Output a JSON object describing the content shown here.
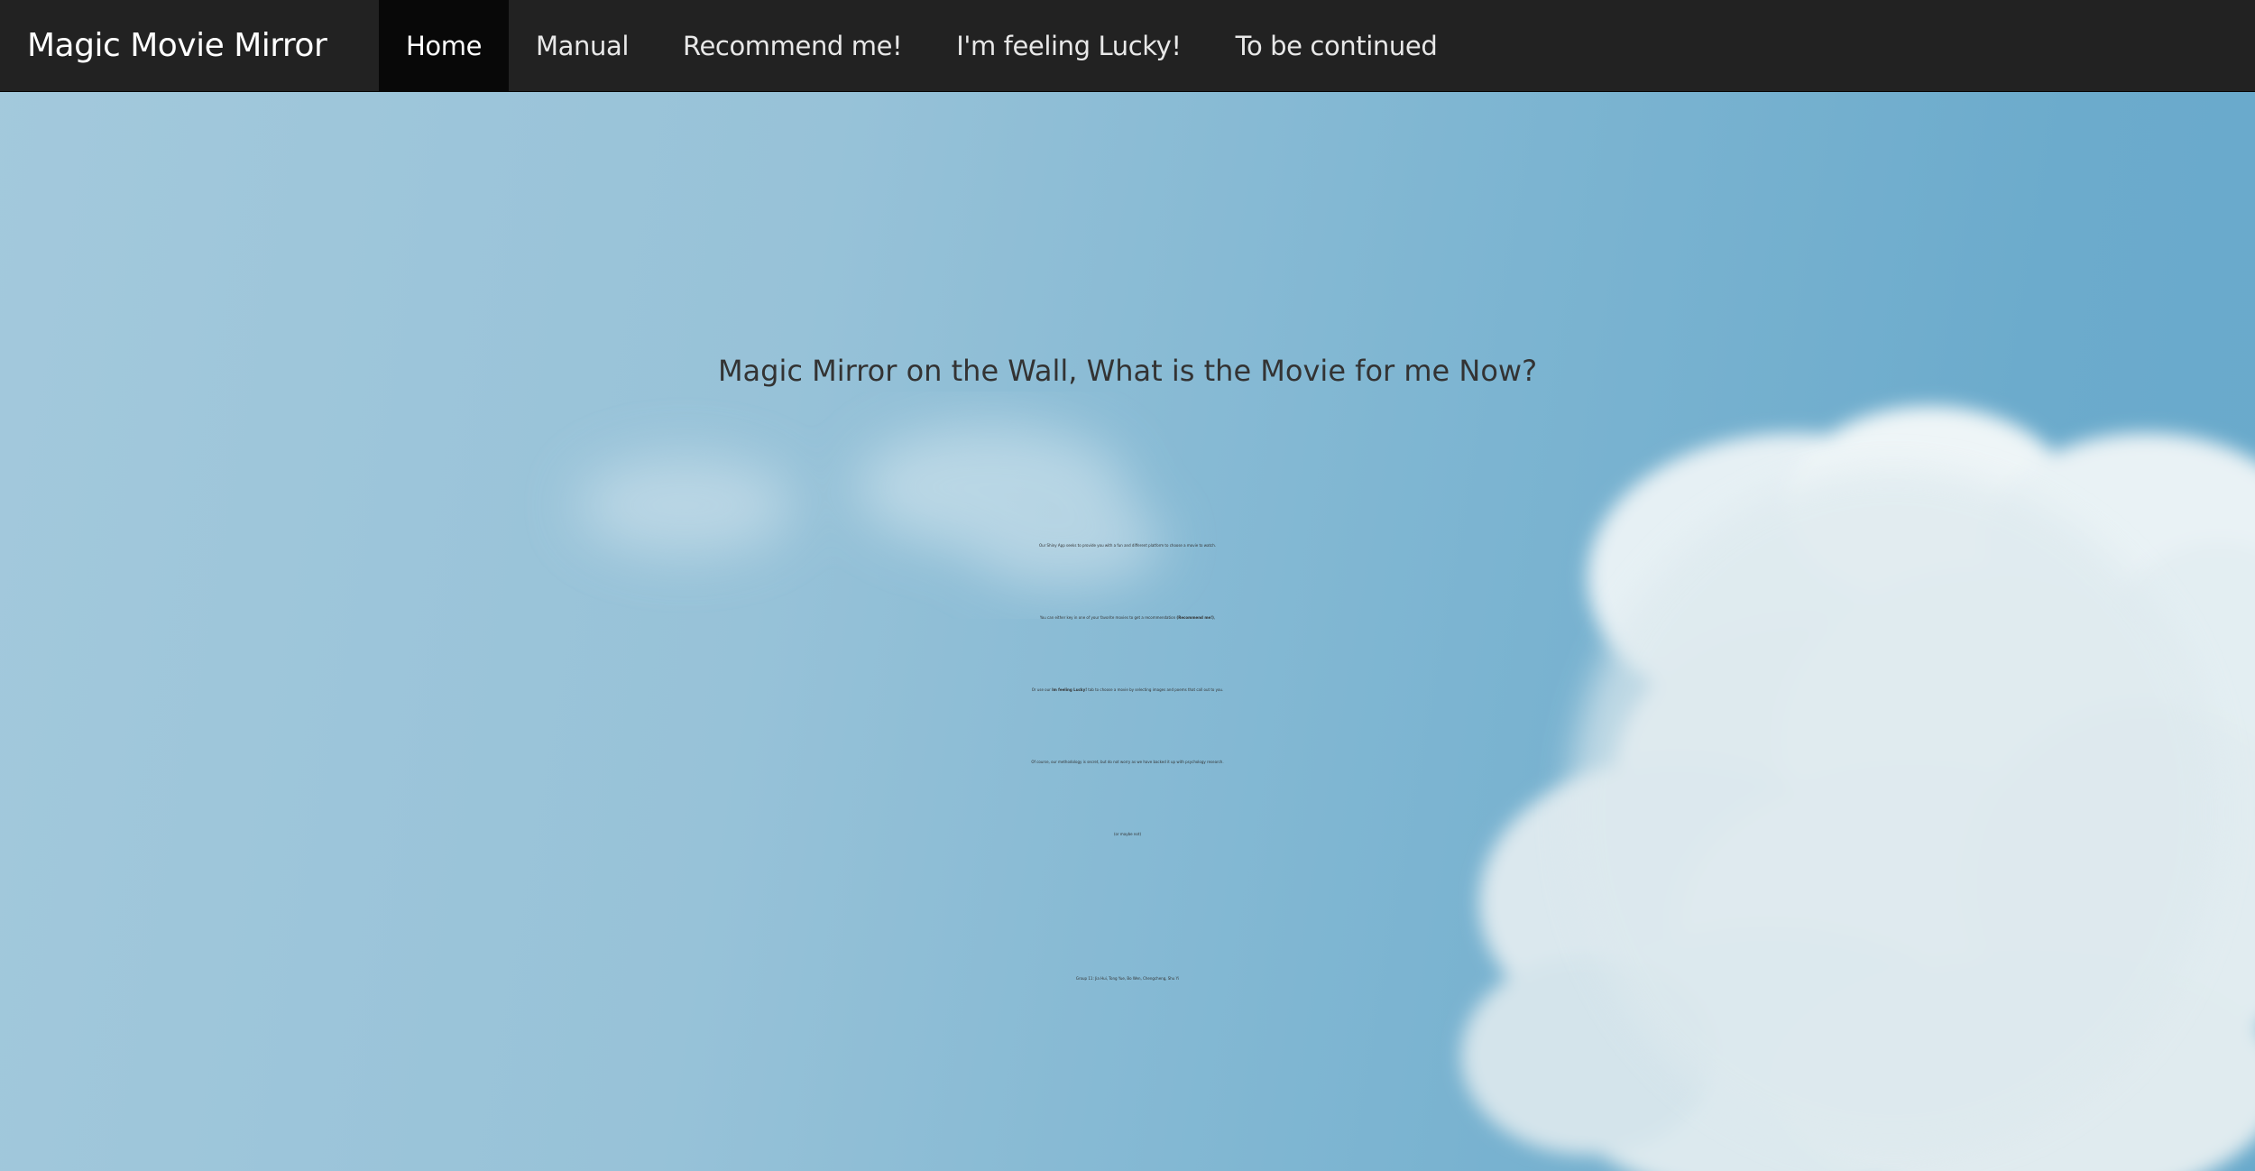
{
  "navbar": {
    "brand": "Magic Movie Mirror",
    "tabs": [
      {
        "label": "Home",
        "active": true
      },
      {
        "label": "Manual",
        "active": false
      },
      {
        "label": "Recommend me!",
        "active": false
      },
      {
        "label": "I'm feeling Lucky!",
        "active": false
      },
      {
        "label": "To be continued",
        "active": false
      }
    ]
  },
  "main": {
    "title": "Magic Mirror on the Wall, What is the Movie for me Now?",
    "line1": "Our Shiny App seeks to provide you with a fun and different platform to choose a movie to watch.",
    "line2_pre": "You can either key in one of your favorite movies to get a recommendation ",
    "line2_bold": "(Recommend me!)",
    "line2_post": ",",
    "line3_pre": "Or use our ",
    "line3_bold": "Im feeling Lucky!",
    "line3_post": " tab to choose a movie by selecting images and poems that call out to you.",
    "line4": "Of course, our methodology is secret, but do not worry as we have backed it up with psychology research.",
    "line5": "(or maybe not)",
    "group": "Group 11: Jia Hui, Tong Yue, Bo Wen, Chengcheng, Shu Yi"
  },
  "colors": {
    "navbar_bg": "#222222",
    "active_tab_bg": "#080808",
    "text": "#333333",
    "sky": "#8fbfd6"
  },
  "icons": {
    "background": "sky-with-clouds-image"
  }
}
